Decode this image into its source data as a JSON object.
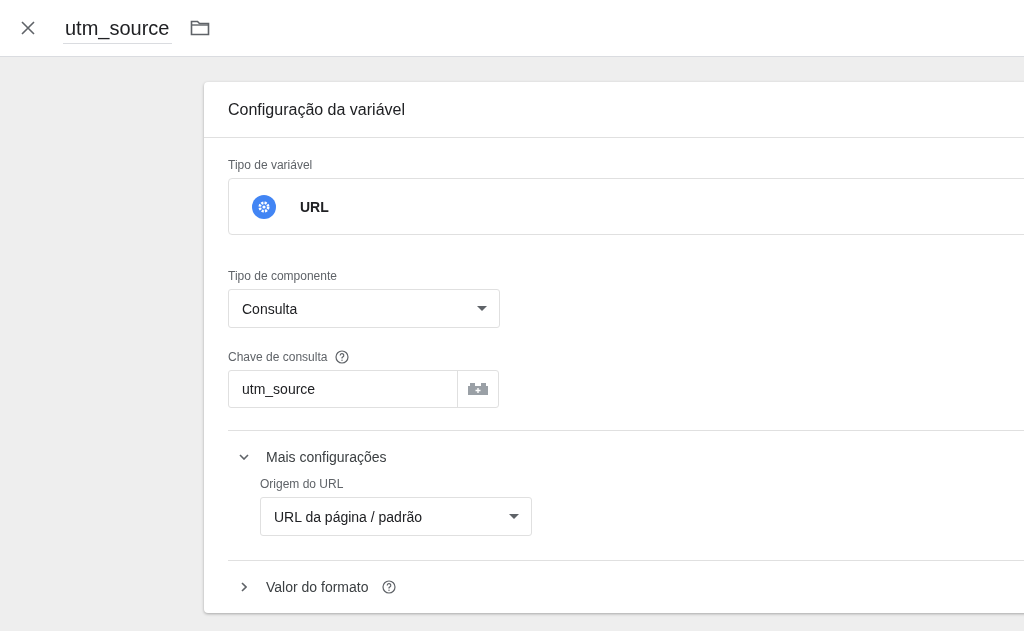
{
  "header": {
    "name": "utm_source"
  },
  "card": {
    "title": "Configuração da variável",
    "variable_type": {
      "label": "Tipo de variável",
      "value": "URL"
    },
    "fields": [
      {
        "kind": "select",
        "label": "Tipo de componente",
        "value": "Consulta",
        "help": false
      },
      {
        "kind": "input",
        "label": "Chave de consulta",
        "value": "utm_source",
        "help": true
      }
    ],
    "sections": [
      {
        "title": "Mais configurações",
        "expanded": true,
        "help": false,
        "fields": [
          {
            "kind": "select",
            "label": "Origem do URL",
            "value": "URL da página / padrão",
            "help": false
          }
        ]
      },
      {
        "title": "Valor do formato",
        "expanded": false,
        "help": true
      }
    ]
  }
}
